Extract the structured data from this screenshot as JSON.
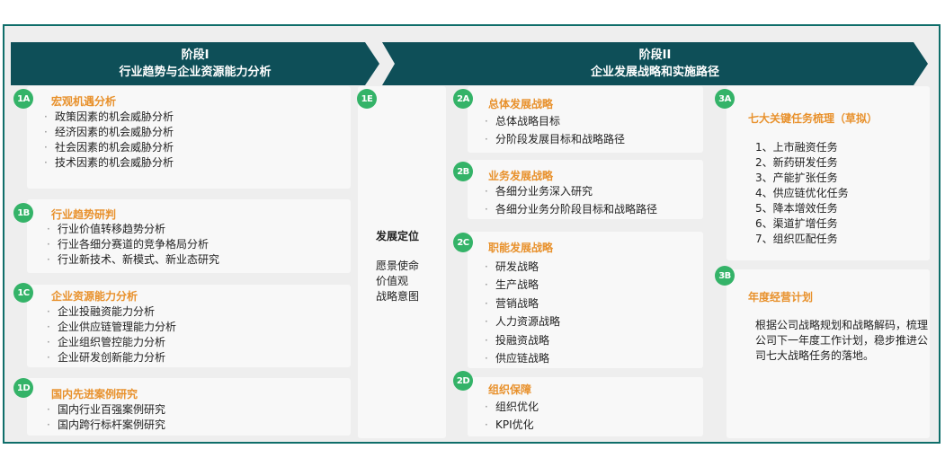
{
  "phase1": {
    "line1": "阶段I",
    "line2": "行业趋势与企业资源能力分析"
  },
  "phase2": {
    "line1": "阶段II",
    "line2": "企业发展战略和实施路径"
  },
  "blocks": {
    "b1A": {
      "badge": "1A",
      "title": "宏观机遇分析",
      "items": [
        "政策因素的机会威胁分析",
        "经济因素的机会威胁分析",
        "社会因素的机会威胁分析",
        "技术因素的机会威胁分析"
      ]
    },
    "b1B": {
      "badge": "1B",
      "title": "行业趋势研判",
      "items": [
        "行业价值转移趋势分析",
        "行业各细分赛道的竞争格局分析",
        "行业新技术、新模式、新业态研究"
      ]
    },
    "b1C": {
      "badge": "1C",
      "title": "企业资源能力分析",
      "items": [
        "企业投融资能力分析",
        "企业供应链管理能力分析",
        "企业组织管控能力分析",
        "企业研发创新能力分析"
      ]
    },
    "b1D": {
      "badge": "1D",
      "title": "国内先进案例研究",
      "items": [
        "国内行业百强案例研究",
        "国内跨行标杆案例研究"
      ]
    },
    "b1E": {
      "badge": "1E",
      "title": "发展定位",
      "items": [
        "愿景使命",
        "价值观",
        "战略意图"
      ]
    },
    "b2A": {
      "badge": "2A",
      "title": "总体发展战略",
      "items": [
        "总体战略目标",
        "分阶段发展目标和战略路径"
      ]
    },
    "b2B": {
      "badge": "2B",
      "title": "业务发展战略",
      "items": [
        "各细分业务深入研究",
        "各细分业务分阶段目标和战略路径"
      ]
    },
    "b2C": {
      "badge": "2C",
      "title": "职能发展战略",
      "items": [
        "研发战略",
        "生产战略",
        "营销战略",
        "人力资源战略",
        "投融资战略",
        "供应链战略"
      ]
    },
    "b2D": {
      "badge": "2D",
      "title": "组织保障",
      "items": [
        "组织优化",
        "KPI优化"
      ]
    },
    "b3A": {
      "badge": "3A",
      "title": "七大关键任务梳理（草拟）",
      "items": [
        "1、上市融资任务",
        "2、新药研发任务",
        "3、产能扩张任务",
        "4、供应链优化任务",
        "5、降本增效任务",
        "6、渠道扩增任务",
        "7、组织匹配任务"
      ]
    },
    "b3B": {
      "badge": "3B",
      "title": "年度经营计划",
      "text": "根据公司战略规划和战略解码，梳理公司下一年度工作计划，稳步推进公司七大战略任务的落地。"
    }
  },
  "colors": {
    "header": "#0e4f58",
    "badge": "#34b368",
    "title": "#e8912c",
    "frame": "#0f6e6a"
  }
}
